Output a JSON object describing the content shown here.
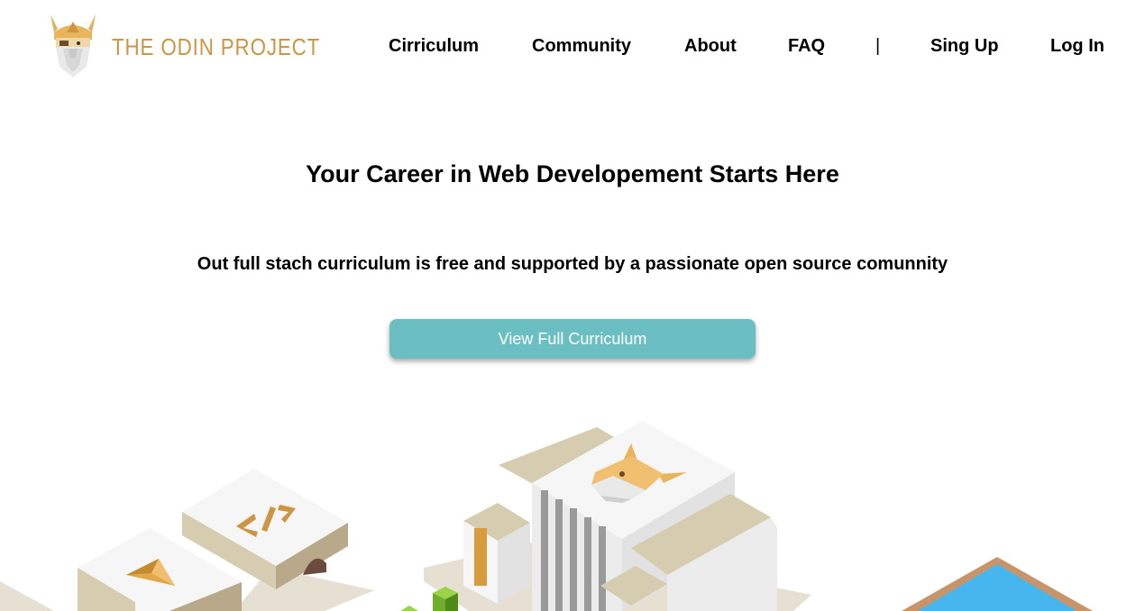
{
  "brand": {
    "name": "THE ODIN PROJECT",
    "accent_color": "#cc9543"
  },
  "nav": {
    "items": [
      {
        "label": "Cirriculum"
      },
      {
        "label": "Community"
      },
      {
        "label": "About"
      },
      {
        "label": "FAQ"
      },
      {
        "label": "|"
      },
      {
        "label": "Sing Up"
      },
      {
        "label": "Log In"
      }
    ]
  },
  "hero": {
    "title": "Your Career in Web Developement Starts Here",
    "subtitle": "Out full stach curriculum is free and supported by a passionate open source comunnity",
    "cta_label": "View Full Curriculum",
    "cta_color": "#6bbfc3"
  },
  "illustration": {
    "description_icons": [
      "odin-viking-icon",
      "code-brackets-icon",
      "triangle-gem-icon",
      "green-cube-icon",
      "pool-icon"
    ]
  }
}
